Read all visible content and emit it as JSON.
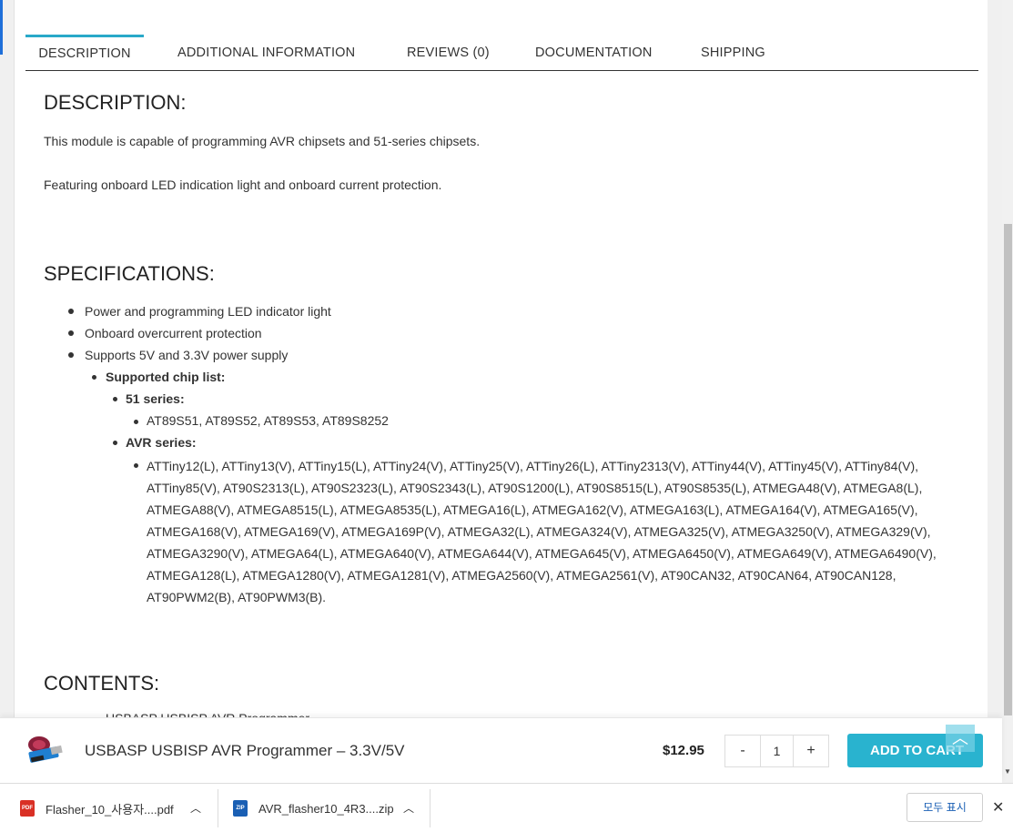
{
  "tabs": [
    {
      "label": "DESCRIPTION"
    },
    {
      "label": "ADDITIONAL INFORMATION"
    },
    {
      "label": "REVIEWS (0)"
    },
    {
      "label": "DOCUMENTATION"
    },
    {
      "label": "SHIPPING"
    }
  ],
  "description": {
    "heading": "DESCRIPTION:",
    "para1": "This module is capable of programming AVR chipsets and 51-series chipsets.",
    "para2": "Featuring onboard LED indication light and onboard current protection."
  },
  "specifications": {
    "heading": "SPECIFICATIONS:",
    "items": [
      "Power and programming LED indicator light",
      "Onboard overcurrent protection",
      "Supports 5V and 3.3V power supply"
    ],
    "chip_list_label": "Supported chip list:",
    "series51_label": "51 series:",
    "series51_chips": "AT89S51, AT89S52, AT89S53, AT89S8252",
    "avr_label": "AVR series:",
    "avr_lines": [
      "ATTiny12(L), ATTiny13(V), ATTiny15(L), ATTiny24(V), ATTiny25(V), ATTiny26(L), ATTiny2313(V), ATTiny44(V), ATTiny45(V), ATTiny84(V),",
      "ATTiny85(V), AT90S2313(L), AT90S2323(L), AT90S2343(L), AT90S1200(L), AT90S8515(L), AT90S8535(L), ATMEGA48(V), ATMEGA8(L),",
      "ATMEGA88(V), ATMEGA8515(L), ATMEGA8535(L), ATMEGA16(L), ATMEGA162(V), ATMEGA163(L), ATMEGA164(V), ATMEGA165(V),",
      "ATMEGA168(V), ATMEGA169(V), ATMEGA169P(V), ATMEGA32(L), ATMEGA324(V), ATMEGA325(V), ATMEGA3250(V), ATMEGA329(V),",
      "ATMEGA3290(V), ATMEGA64(L), ATMEGA640(V), ATMEGA644(V), ATMEGA645(V), ATMEGA6450(V), ATMEGA649(V), ATMEGA6490(V),",
      "ATMEGA128(L), ATMEGA1280(V), ATMEGA1281(V), ATMEGA2560(V), ATMEGA2561(V), AT90CAN32, AT90CAN64, AT90CAN128,",
      "AT90PWM2(B), AT90PWM3(B)."
    ]
  },
  "contents": {
    "heading": "CONTENTS:",
    "first_item_partial": "USBASP USBISP AVR Programmer"
  },
  "cart_bar": {
    "product_name": "USBASP USBISP AVR Programmer – 3.3V/5V",
    "price": "$12.95",
    "qty_minus": "-",
    "qty_value": "1",
    "qty_plus": "+",
    "add_to_cart": "ADD TO CART",
    "back_to_top_icon": "chevron-up-icon"
  },
  "downloads": {
    "items": [
      {
        "name": "Flasher_10_사용자....pdf",
        "icon": "pdf-file-icon",
        "icon_label": "PDF",
        "icon_color": "#d93025"
      },
      {
        "name": "AVR_flasher10_4R3....zip",
        "icon": "zip-file-icon",
        "icon_label": "ZIP",
        "icon_color": "#1a5fb4"
      }
    ],
    "show_all": "모두 표시",
    "close": "✕"
  },
  "colors": {
    "accent": "#29a9c9",
    "add_to_cart_bg": "#29b3cf"
  }
}
